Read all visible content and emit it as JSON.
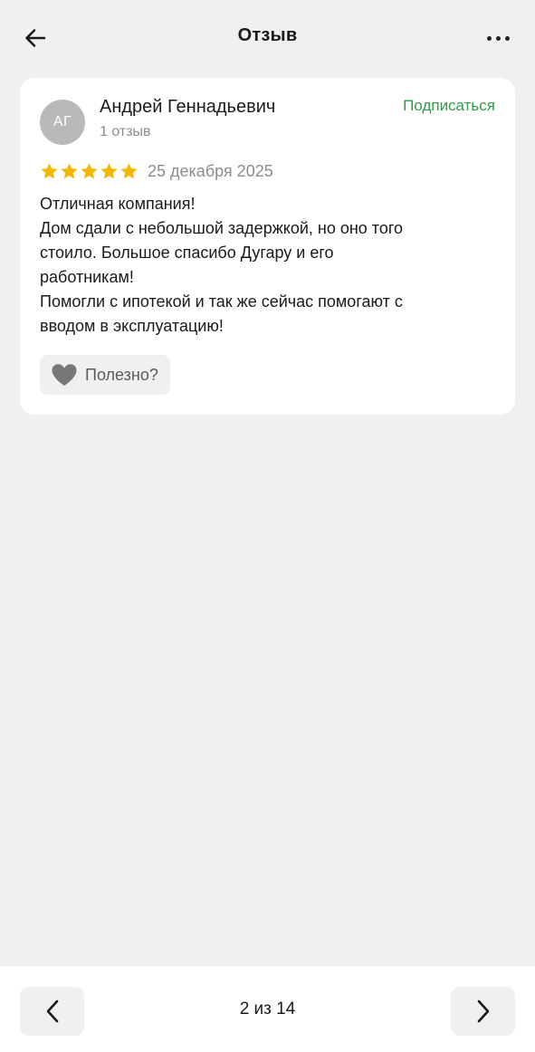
{
  "header": {
    "title": "Отзыв",
    "back_icon": "arrow-left-icon",
    "more_icon": "more-horizontal-icon"
  },
  "review": {
    "author_initials": "АГ",
    "author_name": "Андрей Геннадьевич",
    "author_review_count": "1 отзыв",
    "subscribe_label": "Подписаться",
    "rating": 5,
    "rating_max": 5,
    "date": "25 декабря 2025",
    "text_lines": [
      "Отличная компания!",
      "Дом сдали с небольшой задержкой, но оно того",
      "стоило. Большое спасибо Дугару и его",
      "работникам!",
      "Помогли с ипотекой и так же сейчас помогают с",
      "вводом в эксплуатацию!"
    ],
    "useful_label": "Полезно?",
    "useful_icon": "heart-icon"
  },
  "pagination": {
    "text": "2 из 14",
    "prev_icon": "chevron-left-icon",
    "next_icon": "chevron-right-icon"
  },
  "colors": {
    "background": "#f0f0f0",
    "card": "#ffffff",
    "accent_green": "#2e9b45",
    "star": "#f2b705",
    "secondary_text": "#8c8c8c",
    "avatar": "#b9b9b9"
  }
}
